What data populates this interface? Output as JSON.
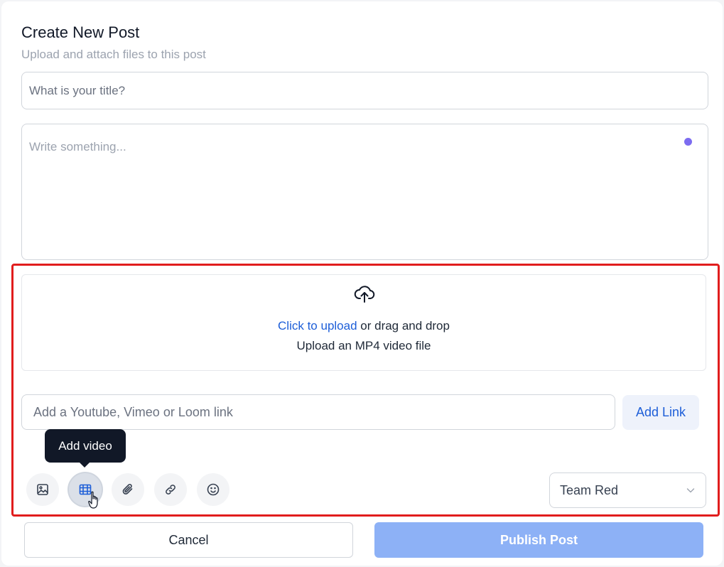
{
  "header": {
    "title": "Create New Post",
    "subtitle": "Upload and attach files to this post"
  },
  "form": {
    "title_placeholder": "What is your title?",
    "title_value": "",
    "body_placeholder": "Write something..."
  },
  "video_upload": {
    "upload_link": "Click to upload",
    "drag_text": " or drag and drop",
    "hint": "Upload an MP4 video file",
    "link_placeholder": "Add a Youtube, Vimeo or Loom link",
    "link_value": "",
    "add_link_label": "Add Link"
  },
  "toolbar": {
    "tooltip": "Add video",
    "buttons": [
      {
        "icon": "image-icon",
        "active": false
      },
      {
        "icon": "video-icon",
        "active": true
      },
      {
        "icon": "paperclip-icon",
        "active": false
      },
      {
        "icon": "link-icon",
        "active": false
      },
      {
        "icon": "emoji-icon",
        "active": false
      }
    ],
    "team_select": {
      "selected": "Team Red"
    }
  },
  "actions": {
    "cancel_label": "Cancel",
    "publish_label": "Publish Post"
  },
  "colors": {
    "accent": "#1d5ed8",
    "publish_disabled": "#8db1f6",
    "highlight": "#e11d1d",
    "status_dot": "#7c6cf0"
  }
}
